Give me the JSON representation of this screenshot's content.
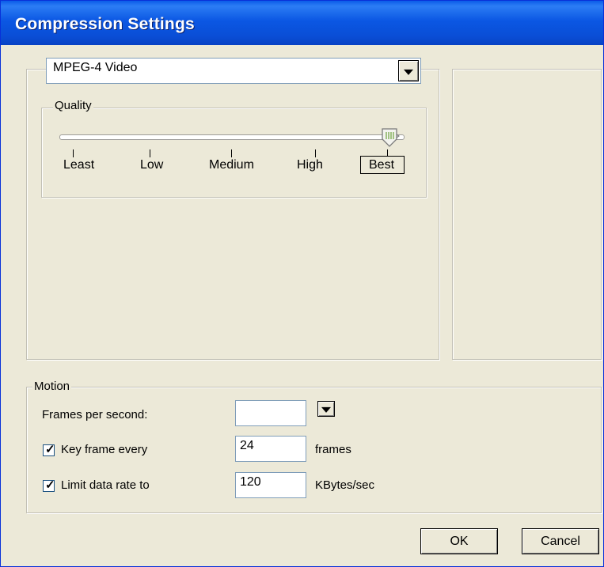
{
  "window": {
    "title": "Compression Settings"
  },
  "compressor": {
    "selected": "MPEG-4 Video"
  },
  "quality": {
    "legend": "Quality",
    "levels": [
      "Least",
      "Low",
      "Medium",
      "High",
      "Best"
    ],
    "selected_index": 4,
    "slider_value_fraction": 1.0
  },
  "motion": {
    "legend": "Motion",
    "fps": {
      "label": "Frames per second:",
      "value": ""
    },
    "keyframe": {
      "label": "Key frame every",
      "checked": true,
      "value": "24",
      "units": "frames"
    },
    "datarate": {
      "label": "Limit data rate to",
      "checked": true,
      "value": "120",
      "units": "KBytes/sec"
    }
  },
  "buttons": {
    "ok": "OK",
    "cancel": "Cancel"
  },
  "colors": {
    "titlebar": "#0A4ED6",
    "dialog_bg": "#ECE9D8",
    "field_border": "#7F9DB9"
  }
}
